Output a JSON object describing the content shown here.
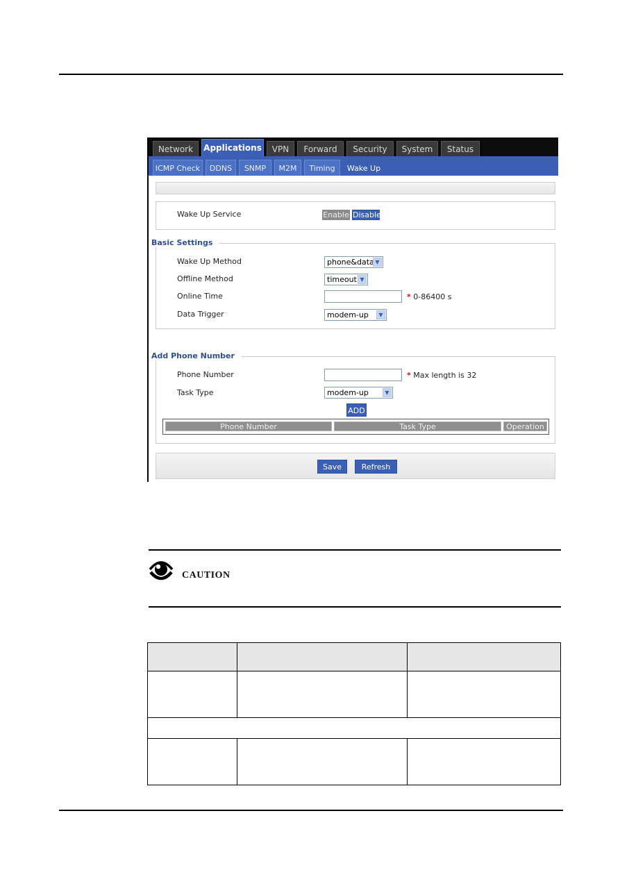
{
  "router_ui": {
    "main_tabs": [
      {
        "label": "Network",
        "active": false
      },
      {
        "label": "Applications",
        "active": true
      },
      {
        "label": "VPN",
        "active": false
      },
      {
        "label": "Forward",
        "active": false
      },
      {
        "label": "Security",
        "active": false
      },
      {
        "label": "System",
        "active": false
      },
      {
        "label": "Status",
        "active": false
      }
    ],
    "sub_tabs": [
      {
        "label": "ICMP Check",
        "active": false
      },
      {
        "label": "DDNS",
        "active": false
      },
      {
        "label": "SNMP",
        "active": false
      },
      {
        "label": "M2M",
        "active": false
      },
      {
        "label": "Timing",
        "active": false
      },
      {
        "label": "Wake Up",
        "active": true
      }
    ],
    "service": {
      "label": "Wake Up Service",
      "enable_label": "Enable",
      "disable_label": "Disable",
      "selected": "Disable"
    },
    "basic_settings": {
      "legend": "Basic Settings",
      "wake_up_method": {
        "label": "Wake Up Method",
        "value": "phone&data"
      },
      "offline_method": {
        "label": "Offline Method",
        "value": "timeout"
      },
      "online_time": {
        "label": "Online Time",
        "value": "",
        "hint": "0-86400 s"
      },
      "data_trigger": {
        "label": "Data Trigger",
        "value": "modem-up"
      }
    },
    "add_phone": {
      "legend": "Add Phone Number",
      "phone_number": {
        "label": "Phone Number",
        "value": "",
        "hint": "Max length is 32"
      },
      "task_type": {
        "label": "Task Type",
        "value": "modem-up"
      },
      "add_label": "ADD",
      "table_headers": [
        "Phone Number",
        "Task Type",
        "Operation"
      ]
    },
    "save_label": "Save",
    "refresh_label": "Refresh",
    "required_mark": "*",
    "colors": {
      "accent": "#3a5fb5",
      "nav_bg": "#0c0c0c",
      "required": "#c0102a",
      "legend": "#2e4f8c"
    }
  },
  "caution": {
    "label": "CAUTION",
    "icon": "eye-icon"
  }
}
